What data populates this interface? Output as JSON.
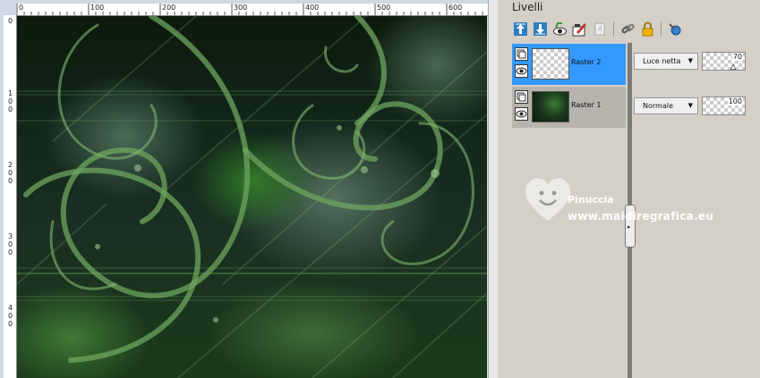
{
  "ruler_top": {
    "labels": [
      "0",
      "100",
      "200",
      "300",
      "400",
      "500",
      "600"
    ]
  },
  "ruler_left": {
    "labels": [
      "0",
      "1\n0\n0",
      "2\n0\n0",
      "3\n0\n0",
      "4\n0\n0"
    ]
  },
  "palette": {
    "title": "Livelli",
    "toolbar": {
      "icons": [
        "move-layer-up-icon",
        "move-layer-down-icon",
        "visibility-toggle-icon",
        "layer-properties-icon",
        "delete-layer-icon",
        "link-icon",
        "lock-icon",
        "pin-icon"
      ]
    }
  },
  "layers": [
    {
      "name": "Raster 2",
      "blend_mode": "Luce netta",
      "opacity": "70",
      "opacity_value": 70,
      "selected": true
    },
    {
      "name": "Raster 1",
      "blend_mode": "Normale",
      "opacity": "100",
      "opacity_value": 100,
      "selected": false
    }
  ],
  "watermark": {
    "name": "Pinuccia",
    "url": "www.maidiregrafica.eu"
  },
  "colors": {
    "selected_row": "#3399ff",
    "unselected_row": "#b7b3ad",
    "panel_bg": "#d4d0c8",
    "accent_green": "#2f7a28"
  }
}
